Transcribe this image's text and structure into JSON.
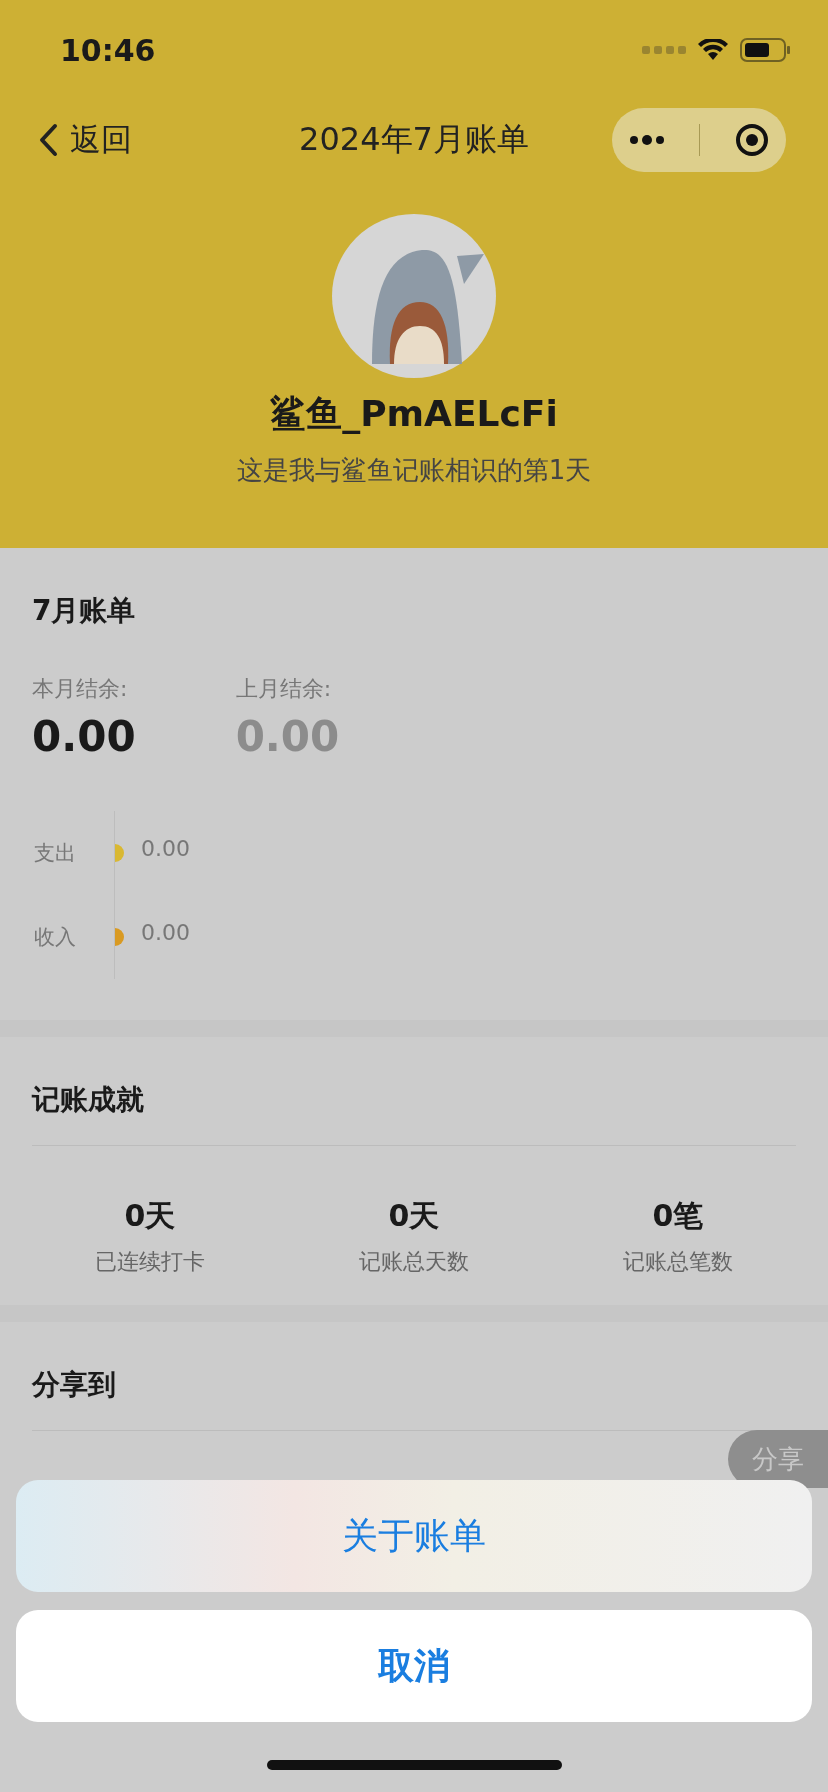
{
  "status_bar": {
    "time": "10:46"
  },
  "nav": {
    "back": "返回",
    "title": "2024年7月账单"
  },
  "profile": {
    "name": "鲨鱼_PmAELcFi",
    "subtitle": "这是我与鲨鱼记账相识的第1天"
  },
  "bill": {
    "title": "7月账单",
    "balances": [
      {
        "label": "本月结余:",
        "value": "0.00",
        "muted": false
      },
      {
        "label": "上月结余:",
        "value": "0.00",
        "muted": true
      }
    ],
    "flows": [
      {
        "label": "支出",
        "value": "0.00",
        "color": "#d9b832"
      },
      {
        "label": "收入",
        "value": "0.00",
        "color": "#d99a22"
      }
    ]
  },
  "achievements": {
    "title": "记账成就",
    "stats": [
      {
        "value": "0天",
        "label": "已连续打卡"
      },
      {
        "value": "0天",
        "label": "记账总天数"
      },
      {
        "value": "0笔",
        "label": "记账总笔数"
      }
    ]
  },
  "share": {
    "title": "分享到",
    "float_button": "分享"
  },
  "action_sheet": {
    "actions": [
      "关于账单"
    ],
    "cancel": "取消"
  }
}
